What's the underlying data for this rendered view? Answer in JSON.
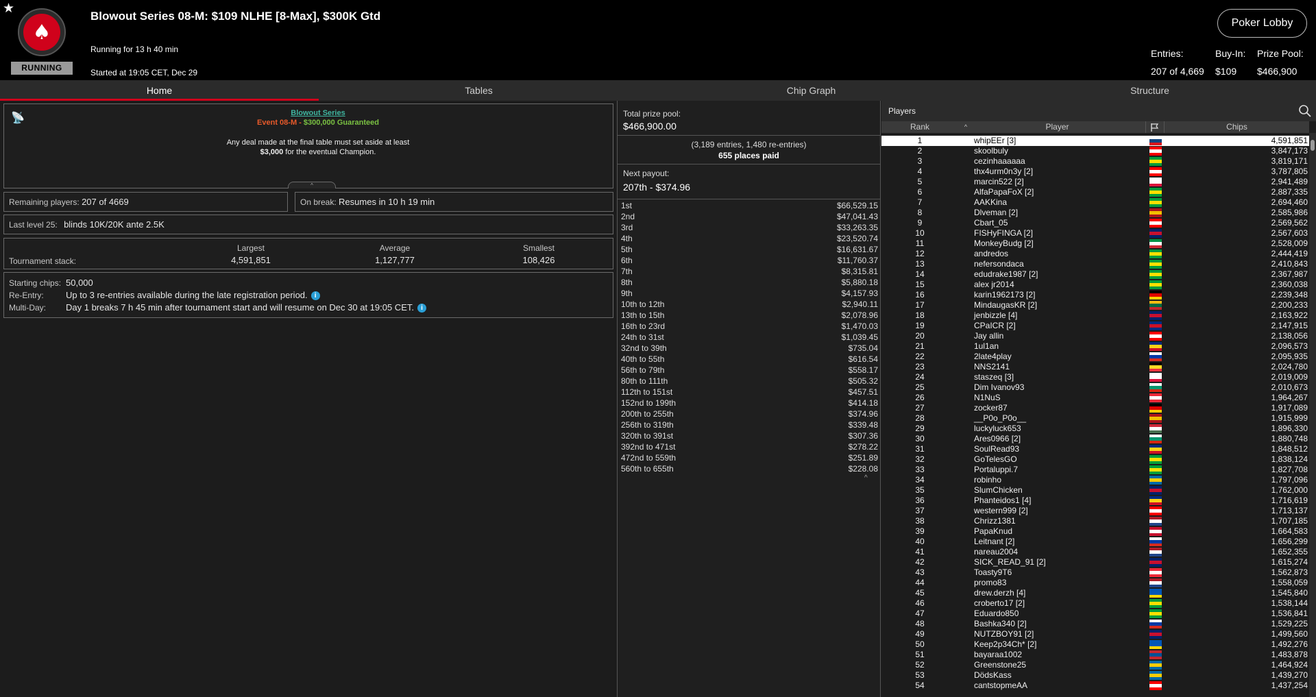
{
  "header": {
    "title": "Blowout Series 08-M: $109 NLHE [8-Max], $300K Gtd",
    "running_for": "Running for 13 h 40 min",
    "started": "Started at 19:05 CET, Dec 29",
    "status_badge": "RUNNING",
    "lobby_button": "Poker Lobby",
    "entries_label": "Entries:",
    "entries_value": "207 of 4,669",
    "buyin_label": "Buy-In:",
    "buyin_value": "$109",
    "prizepool_label": "Prize Pool:",
    "prizepool_value": "$466,900"
  },
  "tabs": [
    "Home",
    "Tables",
    "Chip Graph",
    "Structure"
  ],
  "home": {
    "series_link": "Blowout Series",
    "event_name": "Event 08-M",
    "event_sep": " - ",
    "event_guarantee": "$300,000 Guaranteed",
    "deal_line1": "Any deal made at the final table must set aside at least",
    "deal_amount": "$3,000",
    "deal_line2": " for the eventual Champion.",
    "remaining_label": "Remaining players:",
    "remaining_value": "207 of 4669",
    "break_label": "On break:",
    "break_value": "Resumes in 10 h 19 min",
    "last_level_label": "Last level 25:",
    "last_level_value": "blinds 10K/20K ante 2.5K",
    "stack_label": "Tournament stack:",
    "largest_label": "Largest",
    "largest_value": "4,591,851",
    "average_label": "Average",
    "average_value": "1,127,777",
    "smallest_label": "Smallest",
    "smallest_value": "108,426",
    "starting_chips_label": "Starting chips:",
    "starting_chips_value": "50,000",
    "reentry_label": "Re-Entry:",
    "reentry_value": "Up to 3 re-entries available during the late registration period.",
    "multiday_label": "Multi-Day:",
    "multiday_value": "Day 1 breaks 7 h 45 min after tournament start and will resume on Dec 30 at 19:05 CET."
  },
  "prizes": {
    "total_label": "Total prize pool:",
    "total_value": "$466,900.00",
    "entries_note": "(3,189 entries, 1,480 re-entries)",
    "places_paid": "655 places paid",
    "next_payout_label": "Next payout:",
    "next_payout_value": "207th - $374.96",
    "payouts": [
      [
        "1st",
        "$66,529.15"
      ],
      [
        "2nd",
        "$47,041.43"
      ],
      [
        "3rd",
        "$33,263.35"
      ],
      [
        "4th",
        "$23,520.74"
      ],
      [
        "5th",
        "$16,631.67"
      ],
      [
        "6th",
        "$11,760.37"
      ],
      [
        "7th",
        "$8,315.81"
      ],
      [
        "8th",
        "$5,880.18"
      ],
      [
        "9th",
        "$4,157.93"
      ],
      [
        "10th to 12th",
        "$2,940.11"
      ],
      [
        "13th to 15th",
        "$2,078.96"
      ],
      [
        "16th to 23rd",
        "$1,470.03"
      ],
      [
        "24th to 31st",
        "$1,039.45"
      ],
      [
        "32nd to 39th",
        "$735.04"
      ],
      [
        "40th to 55th",
        "$616.54"
      ],
      [
        "56th to 79th",
        "$558.17"
      ],
      [
        "80th to 111th",
        "$505.32"
      ],
      [
        "112th to 151st",
        "$457.51"
      ],
      [
        "152nd to 199th",
        "$414.18"
      ],
      [
        "200th to 255th",
        "$374.96"
      ],
      [
        "256th to 319th",
        "$339.48"
      ],
      [
        "320th to 391st",
        "$307.36"
      ],
      [
        "392nd to 471st",
        "$278.22"
      ],
      [
        "472nd to 559th",
        "$251.89"
      ],
      [
        "560th to 655th",
        "$228.08"
      ]
    ]
  },
  "players": {
    "title": "Players",
    "col_rank": "Rank",
    "col_player": "Player",
    "col_chips": "Chips",
    "rows": [
      [
        "1",
        "whipEEr [3]",
        "4,591,851",
        [
          "#ffffff",
          "#11457e",
          "#d7141a"
        ]
      ],
      [
        "2",
        "skoolbuly",
        "3,847,173",
        [
          "#ff0000",
          "#ffffff",
          "#ff0000"
        ]
      ],
      [
        "3",
        "cezinhaaaaaa",
        "3,819,171",
        [
          "#009c3b",
          "#ffdf00",
          "#009c3b"
        ]
      ],
      [
        "4",
        "thx4urm0n3y [2]",
        "3,787,805",
        [
          "#ff0000",
          "#ffffff",
          "#ff0000"
        ]
      ],
      [
        "5",
        "marcin522 [2]",
        "2,941,489",
        [
          "#ffffff",
          "#ffffff",
          "#dc143c"
        ]
      ],
      [
        "6",
        "AlfaPapaFoX [2]",
        "2,887,335",
        [
          "#009c3b",
          "#ffdf00",
          "#009c3b"
        ]
      ],
      [
        "7",
        "AAKKina",
        "2,694,460",
        [
          "#009c3b",
          "#ffdf00",
          "#009c3b"
        ]
      ],
      [
        "8",
        "Dlveman [2]",
        "2,585,986",
        [
          "#aa151b",
          "#f1bf00",
          "#aa151b"
        ]
      ],
      [
        "9",
        "Cbart_05",
        "2,569,562",
        [
          "#ff0000",
          "#ffffff",
          "#ff0000"
        ]
      ],
      [
        "10",
        "FISHyFINGA [2]",
        "2,567,603",
        [
          "#012169",
          "#c8102e",
          "#012169"
        ]
      ],
      [
        "11",
        "MonkeyBudg [2]",
        "2,528,009",
        [
          "#009246",
          "#ffffff",
          "#ce2b37"
        ]
      ],
      [
        "12",
        "andredos",
        "2,444,419",
        [
          "#009c3b",
          "#ffdf00",
          "#009c3b"
        ]
      ],
      [
        "13",
        "nefersondaca",
        "2,410,843",
        [
          "#009c3b",
          "#ffdf00",
          "#009c3b"
        ]
      ],
      [
        "14",
        "edudrake1987 [2]",
        "2,367,987",
        [
          "#009c3b",
          "#ffdf00",
          "#009c3b"
        ]
      ],
      [
        "15",
        "alex jr2014",
        "2,360,038",
        [
          "#009c3b",
          "#ffdf00",
          "#009c3b"
        ]
      ],
      [
        "16",
        "karin1962173 [2]",
        "2,239,348",
        [
          "#000000",
          "#dd0000",
          "#ffce00"
        ]
      ],
      [
        "17",
        "MindaugasKR [2]",
        "2,200,233",
        [
          "#fdb913",
          "#006a44",
          "#c1272d"
        ]
      ],
      [
        "18",
        "jenbizzle [4]",
        "2,163,922",
        [
          "#012169",
          "#c8102e",
          "#012169"
        ]
      ],
      [
        "19",
        "CPaICR [2]",
        "2,147,915",
        [
          "#002b7f",
          "#ce1126",
          "#002b7f"
        ]
      ],
      [
        "20",
        "Jay allin",
        "2,138,056",
        [
          "#ff0000",
          "#ffffff",
          "#ff0000"
        ]
      ],
      [
        "21",
        "1ul1an",
        "2,096,573",
        [
          "#002b7f",
          "#fcd116",
          "#ce1126"
        ]
      ],
      [
        "22",
        "2late4play",
        "2,095,935",
        [
          "#ffffff",
          "#0039a6",
          "#d52b1e"
        ]
      ],
      [
        "23",
        "NNS2141",
        "2,024,780",
        [
          "#000000",
          "#fdda24",
          "#ef3340"
        ]
      ],
      [
        "24",
        "staszeq [3]",
        "2,019,009",
        [
          "#ffffff",
          "#ffffff",
          "#dc143c"
        ]
      ],
      [
        "25",
        "Dim Ivanov93",
        "2,010,673",
        [
          "#ffffff",
          "#00966e",
          "#d62612"
        ]
      ],
      [
        "26",
        "N1NuS",
        "1,964,267",
        [
          "#ed2939",
          "#ffffff",
          "#ed2939"
        ]
      ],
      [
        "27",
        "zocker87",
        "1,917,089",
        [
          "#000000",
          "#dd0000",
          "#ffce00"
        ]
      ],
      [
        "28",
        "__P0o_P0o__",
        "1,915,999",
        [
          "#aa151b",
          "#f1bf00",
          "#aa151b"
        ]
      ],
      [
        "29",
        "luckyluck653",
        "1,896,330",
        [
          "#ce2939",
          "#ffffff",
          "#477050"
        ]
      ],
      [
        "30",
        "Ares0966 [2]",
        "1,880,748",
        [
          "#ffffff",
          "#00966e",
          "#d62612"
        ]
      ],
      [
        "31",
        "SoulRead93",
        "1,848,512",
        [
          "#002b7f",
          "#fcd116",
          "#ce1126"
        ]
      ],
      [
        "32",
        "GoTelesGO",
        "1,838,124",
        [
          "#009c3b",
          "#ffdf00",
          "#009c3b"
        ]
      ],
      [
        "33",
        "Portaluppi.7",
        "1,827,708",
        [
          "#009c3b",
          "#ffdf00",
          "#009c3b"
        ]
      ],
      [
        "34",
        "robinho",
        "1,797,096",
        [
          "#006aa7",
          "#fecc00",
          "#006aa7"
        ]
      ],
      [
        "35",
        "SlumChicken",
        "1,762,000",
        [
          "#012169",
          "#c8102e",
          "#012169"
        ]
      ],
      [
        "36",
        "Phanteidos1 [4]",
        "1,716,619",
        [
          "#002b7f",
          "#fcd116",
          "#ce1126"
        ]
      ],
      [
        "37",
        "western999 [2]",
        "1,713,137",
        [
          "#ff0000",
          "#ffffff",
          "#ff0000"
        ]
      ],
      [
        "38",
        "Chrizz1381",
        "1,707,185",
        [
          "#ae1c28",
          "#ffffff",
          "#21468b"
        ]
      ],
      [
        "39",
        "PapaKnud",
        "1,664,583",
        [
          "#c8102e",
          "#ffffff",
          "#c8102e"
        ]
      ],
      [
        "40",
        "Leitnant [2]",
        "1,656,299",
        [
          "#ffffff",
          "#0039a6",
          "#d52b1e"
        ]
      ],
      [
        "41",
        "nareau2004",
        "1,652,355",
        [
          "#ae1c28",
          "#ffffff",
          "#21468b"
        ]
      ],
      [
        "42",
        "SICK_READ_91 [2]",
        "1,615,274",
        [
          "#012169",
          "#c8102e",
          "#012169"
        ]
      ],
      [
        "43",
        "Toasty9T6",
        "1,562,873",
        [
          "#ed2939",
          "#ffffff",
          "#ed2939"
        ]
      ],
      [
        "44",
        "promo83",
        "1,558,059",
        [
          "#ae1c28",
          "#ffffff",
          "#21468b"
        ]
      ],
      [
        "45",
        "drew.derzh [4]",
        "1,545,840",
        [
          "#0057b7",
          "#0057b7",
          "#ffd700"
        ]
      ],
      [
        "46",
        "croberto17 [2]",
        "1,538,144",
        [
          "#009c3b",
          "#ffdf00",
          "#009c3b"
        ]
      ],
      [
        "47",
        "Eduardo850",
        "1,536,841",
        [
          "#009c3b",
          "#ffdf00",
          "#009c3b"
        ]
      ],
      [
        "48",
        "Bashka340 [2]",
        "1,529,225",
        [
          "#ffffff",
          "#0039a6",
          "#d52b1e"
        ]
      ],
      [
        "49",
        "NUTZBOY91 [2]",
        "1,499,560",
        [
          "#012169",
          "#c8102e",
          "#012169"
        ]
      ],
      [
        "50",
        "Keep2p34Ch* [2]",
        "1,492,276",
        [
          "#0057b7",
          "#0057b7",
          "#ffd700"
        ]
      ],
      [
        "51",
        "bayaraa1002",
        "1,483,878",
        [
          "#c4272f",
          "#015197",
          "#c4272f"
        ]
      ],
      [
        "52",
        "Greenstone25",
        "1,464,924",
        [
          "#006aa7",
          "#fecc00",
          "#006aa7"
        ]
      ],
      [
        "53",
        "DödsKass",
        "1,439,270",
        [
          "#006aa7",
          "#fecc00",
          "#006aa7"
        ]
      ],
      [
        "54",
        "cantstopmeAA",
        "1,437,254",
        [
          "#ff0000",
          "#ffffff",
          "#ff0000"
        ]
      ]
    ]
  }
}
